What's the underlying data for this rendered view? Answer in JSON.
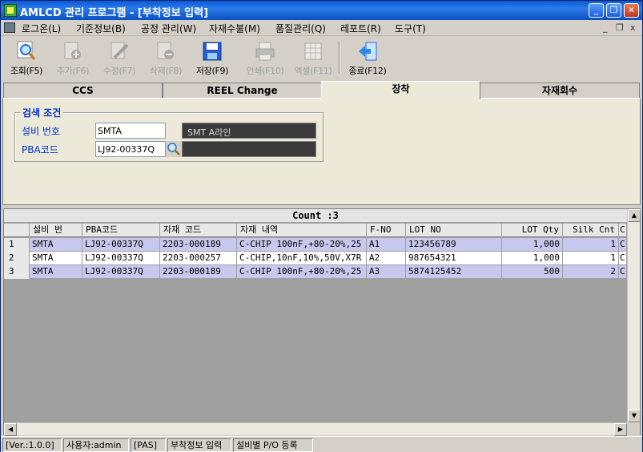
{
  "window": {
    "title": "AMLCD 관리 프로그램 - [부착정보 입력]",
    "minimize": "_",
    "restore": "❐",
    "close": "✕"
  },
  "menu": {
    "items": [
      "로그온(L)",
      "기준정보(B)",
      "공정 관리(W)",
      "자재수불(M)",
      "품질관리(Q)",
      "레포트(R)",
      "도구(T)"
    ],
    "mdi_min": "_",
    "mdi_restore": "❐",
    "mdi_close": "x"
  },
  "toolbar": [
    {
      "label": "조회(F5)",
      "icon": "search-icon",
      "enabled": true
    },
    {
      "label": "추가(F6)",
      "icon": "add-icon",
      "enabled": false
    },
    {
      "label": "수정(F7)",
      "icon": "edit-icon",
      "enabled": false
    },
    {
      "label": "삭제(F8)",
      "icon": "delete-icon",
      "enabled": false
    },
    {
      "label": "저장(F9)",
      "icon": "save-icon",
      "enabled": true
    },
    {
      "label": "인쇄(F10)",
      "icon": "print-icon",
      "enabled": false
    },
    {
      "label": "엑셀(F11)",
      "icon": "excel-icon",
      "enabled": false
    },
    {
      "label": "종료(F12)",
      "icon": "exit-icon",
      "enabled": true
    }
  ],
  "tabs": [
    {
      "label": "CCS",
      "active": false
    },
    {
      "label": "REEL Change",
      "active": false
    },
    {
      "label": "장착",
      "active": true
    },
    {
      "label": "자재회수",
      "active": false
    }
  ],
  "search": {
    "legend": "검색 조건",
    "equipment_label": "설비 번호",
    "equipment_value": "SMTA",
    "equipment_name": "SMT A라인",
    "pba_label": "PBA코드",
    "pba_value": "LJ92-00337Q",
    "pba_name": ""
  },
  "grid": {
    "count_text": "Count :3",
    "columns": [
      "설비 번",
      "PBA코드",
      "자재 코드",
      "자재 내역",
      "F-NO",
      "LOT NO",
      "LOT Qty",
      "Silk Cnt",
      "C"
    ],
    "rows": [
      {
        "num": "1",
        "cells": [
          "SMTA",
          "LJ92-00337Q",
          "2203-000189",
          "C-CHIP 100nF,+80-20%,25",
          "A1",
          "123456789",
          "1,000",
          "1",
          "C"
        ],
        "selected": true
      },
      {
        "num": "2",
        "cells": [
          "SMTA",
          "LJ92-00337Q",
          "2203-000257",
          "C-CHIP,10nF,10%,50V,X7R",
          "A2",
          "987654321",
          "1,000",
          "1",
          "C"
        ],
        "selected": false
      },
      {
        "num": "3",
        "cells": [
          "SMTA",
          "LJ92-00337Q",
          "2203-000189",
          "C-CHIP 100nF,+80-20%,25",
          "A3",
          "5874125452",
          "500",
          "2",
          "C"
        ],
        "selected": true
      }
    ]
  },
  "status": {
    "version": "[Ver.:1.0.0]",
    "user": "사용자:admin",
    "mode": "[PAS]",
    "screen": "부착정보 입력",
    "extra": "설비별 P/O 등록"
  },
  "colors": {
    "titlebar": "#0a5ad8",
    "selected_row": "#c8c8ee",
    "label_blue": "#0033cc"
  }
}
